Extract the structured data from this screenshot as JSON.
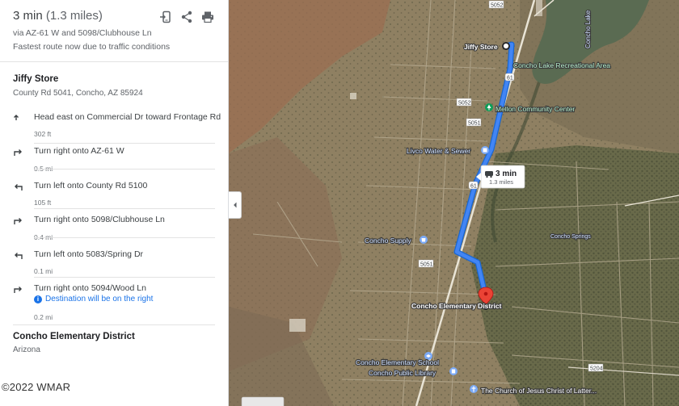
{
  "route": {
    "time": "3 min",
    "distance": "(1.3 miles)",
    "via": "via AZ-61 W and 5098/Clubhouse Ln",
    "status": "Fastest route now due to traffic conditions"
  },
  "actions": [
    {
      "icon": "send-to-phone-icon"
    },
    {
      "icon": "share-icon"
    },
    {
      "icon": "print-icon"
    }
  ],
  "origin": {
    "name": "Jiffy Store",
    "address": "County Rd 5041, Concho, AZ 85924"
  },
  "steps": [
    {
      "icon": "arrow-up-icon",
      "instruction": "Head east on Commercial Dr toward Frontage Rd",
      "distance": "302 ft"
    },
    {
      "icon": "turn-right-icon",
      "instruction": "Turn right onto AZ-61 W",
      "distance": "0.5 mi"
    },
    {
      "icon": "turn-left-icon",
      "instruction": "Turn left onto County Rd 5100",
      "distance": "105 ft"
    },
    {
      "icon": "turn-right-icon",
      "instruction": "Turn right onto 5098/Clubhouse Ln",
      "distance": "0.4 mi"
    },
    {
      "icon": "turn-left-icon",
      "instruction": "Turn left onto 5083/Spring Dr",
      "distance": "0.1 mi"
    },
    {
      "icon": "turn-right-icon",
      "instruction": "Turn right onto 5094/Wood Ln",
      "note": "Destination will be on the right",
      "distance": "0.2 mi"
    }
  ],
  "destination": {
    "name": "Concho Elementary District",
    "address": "Arizona"
  },
  "watermark": "©2022 WMAR",
  "map": {
    "labels": {
      "jiffy_store": "Jiffy Store",
      "concho_lake_area": "Concho Lake Recreational Area",
      "concho_lake": "Concho Lake",
      "mellon_center": "Mellon Community Center",
      "livco": "Livco Water & Sewer",
      "concho_supply": "Concho Supply",
      "concho_springs": "Concho Springs",
      "concho_elementary_district": "Concho Elementary District",
      "concho_elementary_school": "Concho Elementary School",
      "concho_public_library": "Concho Public Library",
      "church": "The Church of Jesus Christ of Latter..."
    },
    "road_labels": [
      "5052",
      "5052",
      "5051",
      "61",
      "61",
      "5051",
      "5204"
    ],
    "route_bubble": {
      "time": "3 min",
      "distance": "1.3 miles"
    },
    "colors": {
      "route": "#4285f4",
      "water": "#5a6b52",
      "pin": "#ea4335",
      "poi_green": "#0f9d58",
      "poi_blue": "#7baaf7"
    }
  }
}
